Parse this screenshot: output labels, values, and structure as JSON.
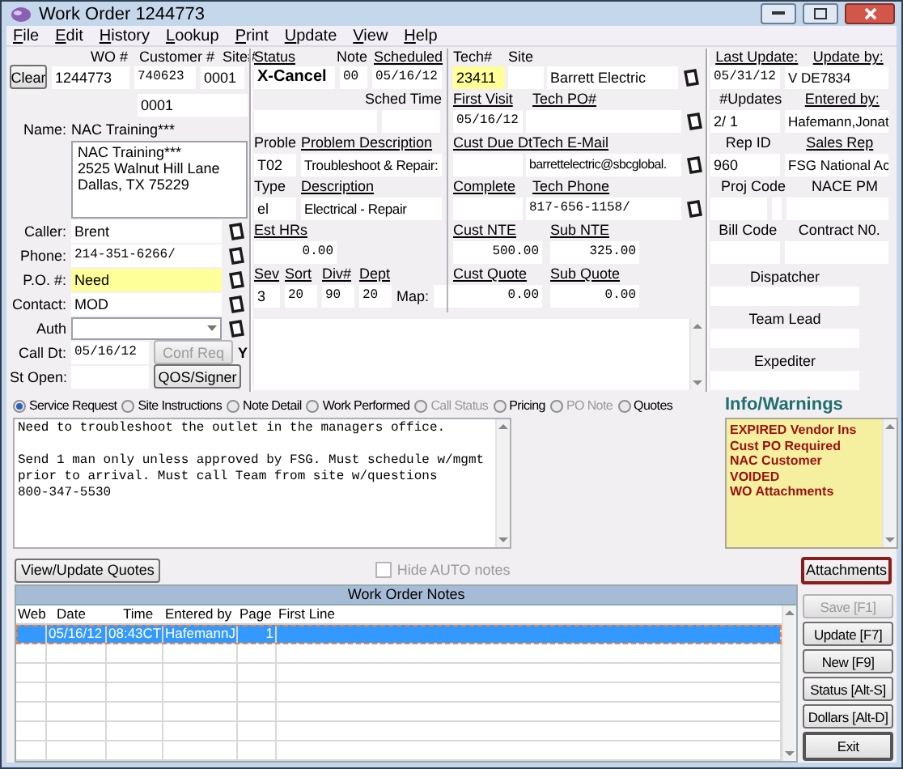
{
  "window": {
    "title": "Work Order 1244773"
  },
  "menu": [
    "File",
    "Edit",
    "History",
    "Lookup",
    "Print",
    "Update",
    "View",
    "Help"
  ],
  "order": {
    "labels": [
      "WO #",
      "Customer #",
      "Site#"
    ],
    "clear_button": "Clear",
    "wo_number": "1244773",
    "customer_number": "740623",
    "site_number": "0001",
    "location_code": "0001"
  },
  "customer": {
    "name_label": "Name:",
    "name": "NAC Training***",
    "address": "NAC Training***\n2525 Walnut Hill Lane\nDallas, TX 75229"
  },
  "contacts": [
    {
      "label": "Caller:",
      "kind": "text",
      "value": "Brent",
      "highlighted": false,
      "lookup": true
    },
    {
      "label": "Phone:",
      "kind": "number",
      "value": "214-351-6266/",
      "highlighted": false,
      "lookup": true
    },
    {
      "label": "P.O. #:",
      "kind": "text",
      "value": "Need",
      "highlighted": true,
      "lookup": true
    },
    {
      "label": "Contact:",
      "kind": "text",
      "value": "MOD",
      "highlighted": false,
      "lookup": true
    },
    {
      "label": "Auth",
      "kind": "dropdown",
      "highlighted": false,
      "lookup": true
    },
    {
      "label": "Call Dt:",
      "kind": "date",
      "value": "05/16/12",
      "highlighted": false,
      "lookup": false,
      "button": {
        "label": "Conf Req",
        "disabled": true
      },
      "flag": "Y"
    },
    {
      "label": "St Open:",
      "kind": "date",
      "highlighted": false,
      "lookup": false,
      "button": {
        "label": "QOS/Signer",
        "disabled": false
      }
    }
  ],
  "job": {
    "status_labels": [
      {
        "text": "Status",
        "link": true
      },
      {
        "text": "Note",
        "link": false
      },
      {
        "text": "Scheduled",
        "link": true
      }
    ],
    "status": "X-Cancel",
    "note": "00",
    "scheduled": "05/16/12",
    "sched_time_label": "Sched Time",
    "problem_labels": [
      {
        "text": "Proble",
        "link": false
      },
      {
        "text": "Problem Description",
        "link": true
      }
    ],
    "problem_code": "T02",
    "problem_description": "Troubleshoot & Repair:",
    "type_labels": [
      {
        "text": "Type",
        "link": false
      },
      {
        "text": "Description",
        "link": true
      }
    ],
    "type_code": "el",
    "type_description": "Electrical - Repair",
    "est_hours_label": {
      "text": "Est HRs",
      "link": true
    },
    "est_hours": "0.00",
    "class_labels": [
      {
        "text": "Sev",
        "link": true
      },
      {
        "text": "Sort",
        "link": true
      },
      {
        "text": "Div#",
        "link": true
      },
      {
        "text": "Dept",
        "link": true
      }
    ],
    "class_values": [
      "3",
      "20",
      "90",
      "20"
    ],
    "map_label": "Map:"
  },
  "tech": {
    "labels": [
      {
        "text": "Tech#",
        "link": false
      },
      {
        "text": "Site",
        "link": false
      }
    ],
    "number": "23411",
    "number_highlighted": true,
    "name": "Barrett Electric",
    "rows": [
      {
        "kind": "contact",
        "labels": [
          {
            "text": "First Visit",
            "link": true
          },
          {
            "text": "Tech PO#",
            "link": true
          }
        ],
        "left_value": "05/16/12"
      },
      {
        "kind": "contact",
        "labels": [
          {
            "text": "Cust Due Dt",
            "link": true
          },
          {
            "text": "Tech E-Mail",
            "link": true
          }
        ],
        "right_value": "barrettelectric@sbcglobal."
      },
      {
        "kind": "contact",
        "labels": [
          {
            "text": "Complete",
            "link": true
          },
          {
            "text": "Tech Phone",
            "link": true
          }
        ],
        "right_value": "817-656-1158/"
      },
      {
        "kind": "amount",
        "labels": [
          {
            "text": "Cust NTE",
            "link": true
          },
          {
            "text": "Sub NTE",
            "link": true
          }
        ],
        "left_value": "500.00",
        "right_value": "325.00"
      },
      {
        "kind": "amount",
        "labels": [
          {
            "text": "Cust Quote",
            "link": true
          },
          {
            "text": "Sub Quote",
            "link": true
          }
        ],
        "left_value": "0.00",
        "right_value": "0.00"
      }
    ]
  },
  "record": {
    "rows": [
      {
        "kind": "pair",
        "labels": [
          {
            "text": "Last Update:",
            "link": true
          },
          {
            "text": "Update by:",
            "link": true
          }
        ],
        "values": [
          "05/31/12",
          "V DE7834"
        ]
      },
      {
        "kind": "pair",
        "labels": [
          {
            "text": "#Updates",
            "link": false
          },
          {
            "text": "Entered by:",
            "link": true
          }
        ],
        "values": [
          "2/ 1",
          "Hafemann,Jonat"
        ]
      },
      {
        "kind": "pair",
        "labels": [
          {
            "text": "Rep ID",
            "link": false
          },
          {
            "text": "Sales Rep",
            "link": true
          }
        ],
        "values": [
          "960",
          "FSG National Ac"
        ]
      },
      {
        "kind": "split",
        "labels": [
          {
            "text": "Proj Code",
            "link": false
          },
          {
            "text": "NACE PM",
            "link": false
          }
        ]
      },
      {
        "kind": "pair",
        "labels": [
          {
            "text": "Bill Code",
            "link": false
          },
          {
            "text": "Contract N0.",
            "link": false
          }
        ]
      }
    ],
    "assignees": [
      "Dispatcher",
      "Team Lead",
      "Expediter"
    ]
  },
  "note_tabs": [
    {
      "label": "Service Request",
      "selected": true,
      "disabled": false
    },
    {
      "label": "Site Instructions",
      "selected": false,
      "disabled": false
    },
    {
      "label": "Note Detail",
      "selected": false,
      "disabled": false
    },
    {
      "label": "Work Performed",
      "selected": false,
      "disabled": false
    },
    {
      "label": "Call Status",
      "selected": false,
      "disabled": true
    },
    {
      "label": "Pricing",
      "selected": false,
      "disabled": false
    },
    {
      "label": "PO Note",
      "selected": false,
      "disabled": true
    },
    {
      "label": "Quotes",
      "selected": false,
      "disabled": false
    }
  ],
  "note_text": "Need to troubleshoot the outlet in the managers office.\n\nSend 1 man only unless approved by FSG. Must schedule w/mgmt\nprior to arrival. Must call Team from site w/questions\n800-347-5530",
  "info": {
    "title": "Info/Warnings",
    "items": [
      "EXPIRED Vendor Ins",
      "Cust PO Required",
      "NAC Customer",
      "VOIDED",
      "WO Attachments"
    ]
  },
  "quotes_button": "View/Update Quotes",
  "hide_auto_notes": {
    "label": "Hide AUTO notes",
    "checked": false,
    "disabled": true
  },
  "attachments_button": {
    "label": "Attachments",
    "highlighted": true
  },
  "notes_table": {
    "title": "Work Order Notes",
    "columns": [
      "Web",
      "Date",
      "Time",
      "Entered by",
      "Page",
      "First Line"
    ],
    "rows": [
      {
        "date": "05/16/12",
        "time": "08:43CT",
        "entered_by": "HafemannJ",
        "page": "1",
        "selected": true
      }
    ]
  },
  "actions": [
    {
      "label": "Save [F1]",
      "disabled": true,
      "default": false
    },
    {
      "label": "Update [F7]",
      "disabled": false,
      "default": false
    },
    {
      "label": "New [F9]",
      "disabled": false,
      "default": false
    },
    {
      "label": "Status [Alt-S]",
      "disabled": false,
      "default": false
    },
    {
      "label": "Dollars [Alt-D]",
      "disabled": false,
      "default": false
    },
    {
      "label": "Exit",
      "disabled": false,
      "default": true
    }
  ]
}
